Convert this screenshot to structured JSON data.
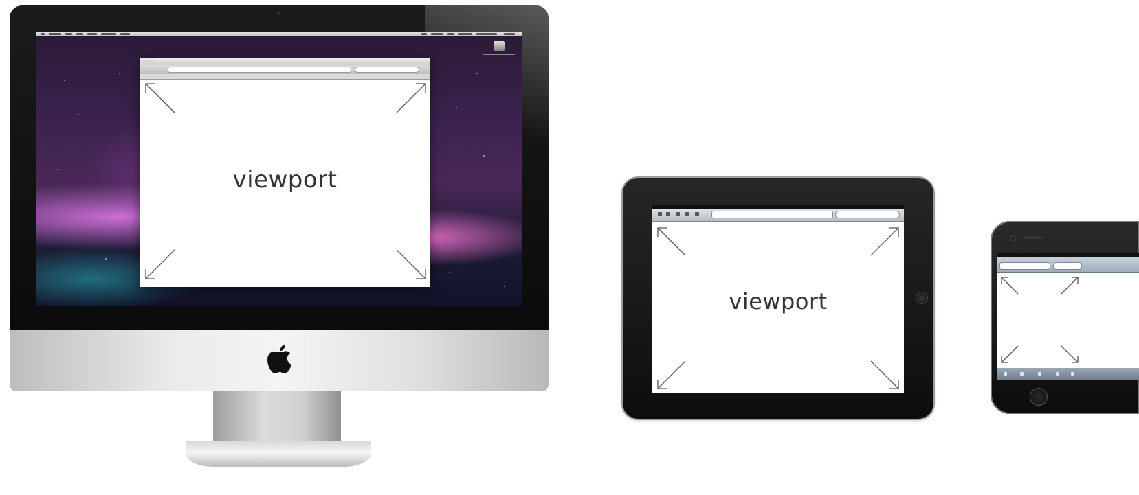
{
  "devices": {
    "desktop": {
      "viewport_label": "viewport"
    },
    "tablet": {
      "viewport_label": "viewport"
    }
  },
  "icons": {
    "apple": "apple-logo-icon",
    "arrows": [
      "arrow-up-left-icon",
      "arrow-up-right-icon",
      "arrow-down-left-icon",
      "arrow-down-right-icon"
    ]
  },
  "colors": {
    "imac_bezel": "#111111",
    "imac_aluminum": "#e6e6e6",
    "wallpaper_accent": "#c86fd6",
    "ipad_body": "#141414",
    "iphone_body": "#141414",
    "arrow_stroke": "#555555"
  }
}
